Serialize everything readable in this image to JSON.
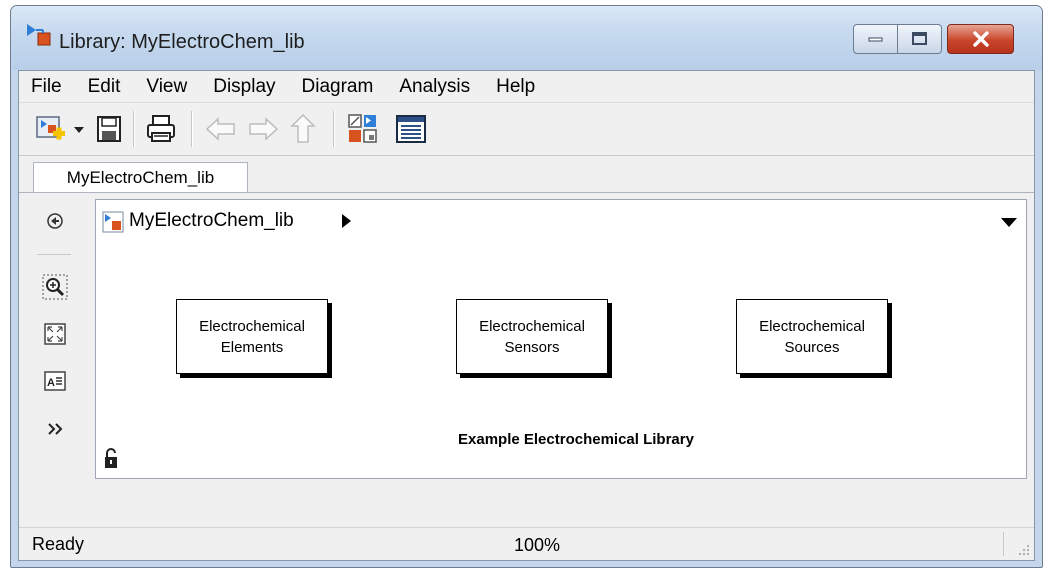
{
  "window": {
    "title": "Library: MyElectroChem_lib"
  },
  "menu": [
    "File",
    "Edit",
    "View",
    "Display",
    "Diagram",
    "Analysis",
    "Help"
  ],
  "toolbar": {
    "icons": [
      "new-library-icon",
      "dropdown-arrow-icon",
      "save-icon",
      "print-icon",
      "back-icon",
      "forward-icon",
      "up-icon",
      "model-browser-icon",
      "library-browser-icon"
    ]
  },
  "tab": {
    "label": "MyElectroChem_lib"
  },
  "address": {
    "path": "MyElectroChem_lib"
  },
  "palette": {
    "icons": [
      "hide-browser-icon",
      "zoom-icon",
      "fit-to-view-icon",
      "annotation-icon",
      "more-icon"
    ]
  },
  "canvas": {
    "blocks": [
      {
        "line1": "Electrochemical",
        "line2": "Elements"
      },
      {
        "line1": "Electrochemical",
        "line2": "Sensors"
      },
      {
        "line1": "Electrochemical",
        "line2": "Sources"
      }
    ],
    "caption": "Example Electrochemical Library"
  },
  "status": {
    "text": "Ready",
    "zoom": "100%"
  },
  "colors": {
    "title_bar": "#c5d8ee",
    "close_button": "#c9462b",
    "chrome": "#f0f0f0"
  }
}
